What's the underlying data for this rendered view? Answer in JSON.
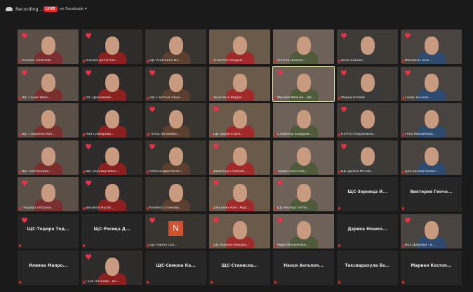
{
  "topbar": {
    "recording_label": "Recording...",
    "live_badge": "LIVE",
    "live_target": "on Facebook ▾"
  },
  "colors": {
    "heart": "#e8324a",
    "live": "#e02828",
    "active_border": "#e6e6a8"
  },
  "participants": [
    {
      "name": "Анелия Запалова",
      "video": true,
      "heart": true
    },
    {
      "name": "Анелия Дотогали...",
      "video": true,
      "heart": true
    },
    {
      "name": "ЩС-Анитална Ил...",
      "video": true,
      "heart": false
    },
    {
      "name": "Анжелла Убидов...",
      "video": true,
      "heart": false
    },
    {
      "name": "Ангела Дмитро...",
      "video": true,
      "heart": false
    },
    {
      "name": "Вили Бикова",
      "video": true,
      "heart": true
    },
    {
      "name": "Ивалана Гили...",
      "video": true,
      "heart": true
    },
    {
      "name": "ЩС-Ганис Иван...",
      "video": true,
      "heart": true
    },
    {
      "name": "Ол. Дрнвадова...",
      "video": true,
      "heart": true
    },
    {
      "name": "ЩС-Гертсна Лери...",
      "video": true,
      "heart": true
    },
    {
      "name": "Христина Йорда...",
      "video": true,
      "heart": false
    },
    {
      "name": "Михаил Иванов - ЩС...",
      "video": true,
      "heart": true,
      "active": true
    },
    {
      "name": "Мариа Казова",
      "video": true,
      "heart": true
    },
    {
      "name": "Ганис Бъчков...",
      "video": true,
      "heart": true
    },
    {
      "name": "ЩС-Габриела Кол...",
      "video": true,
      "heart": false
    },
    {
      "name": "Ная Славарова...",
      "video": true,
      "heart": false
    },
    {
      "name": "Ганна Лачакова...",
      "video": true,
      "heart": true
    },
    {
      "name": "ЩС-Дорита Вел...",
      "video": true,
      "heart": true
    },
    {
      "name": "Славинер Бъдаров...",
      "video": true,
      "heart": false
    },
    {
      "name": "Петя Стоядиновна...",
      "video": true,
      "heart": true
    },
    {
      "name": "Гена Михайлова...",
      "video": true,
      "heart": false
    },
    {
      "name": "ЩС-Светослава...",
      "video": true,
      "heart": false
    },
    {
      "name": "ЩС-Зорница Иван...",
      "video": true,
      "heart": true
    },
    {
      "name": "Александра Миле...",
      "video": true,
      "heart": true
    },
    {
      "name": "Димитър Стоянов...",
      "video": true,
      "heart": true
    },
    {
      "name": "Тодор Понгачев...",
      "video": true,
      "heart": false
    },
    {
      "name": "ЩС-Диана Мечев...",
      "video": true,
      "heart": true
    },
    {
      "name": "Дея Бояева-Велис...",
      "video": true,
      "heart": false
    },
    {
      "name": "Теодора Петрова...",
      "video": true,
      "heart": true
    },
    {
      "name": "Десиела Кусав...",
      "video": true,
      "heart": true
    },
    {
      "name": "Калина Стоянова...",
      "video": true,
      "heart": false
    },
    {
      "name": "Джулиан Али - Ждс...",
      "video": true,
      "heart": true
    },
    {
      "name": "ЩС-Росица Петко...",
      "video": true,
      "heart": true
    },
    {
      "name": "ЩС-Зорница И...",
      "video": false,
      "heart": false
    },
    {
      "name": "Виктория Гинче...",
      "video": false,
      "heart": false
    },
    {
      "name": "ЩС-Тодора Тод...",
      "video": false,
      "heart": true
    },
    {
      "name": "ЩС-Росица Д...",
      "video": false,
      "heart": false
    },
    {
      "name": "ЩС-Нанна Сел...",
      "video": true,
      "heart": true,
      "avatar": "N"
    },
    {
      "name": "ЩС-Кирила Коцева...",
      "video": true,
      "heart": true
    },
    {
      "name": "Мира Масинкова...",
      "video": true,
      "heart": true
    },
    {
      "name": "Дэрина Ношко...",
      "video": false,
      "heart": false
    },
    {
      "name": "Ина Добрева - В...",
      "video": true,
      "heart": true
    },
    {
      "name": "Илияна Мапро...",
      "video": false,
      "heart": false
    },
    {
      "name": "Гена Петкова - Въ...",
      "video": true,
      "heart": true
    },
    {
      "name": "ЩС-Симона Ка...",
      "video": false,
      "heart": false
    },
    {
      "name": "ЩС-Станисла...",
      "video": false,
      "heart": false
    },
    {
      "name": "Нанси Ангелоп...",
      "video": false,
      "heart": false
    },
    {
      "name": "Таксиарахула Бе...",
      "video": false,
      "heart": false
    },
    {
      "name": "Мариен Костоп...",
      "video": false,
      "heart": false
    }
  ]
}
